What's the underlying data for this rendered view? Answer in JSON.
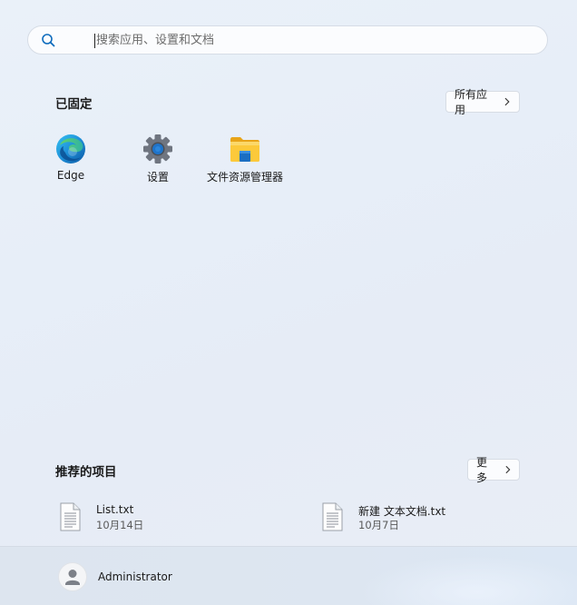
{
  "search": {
    "placeholder": "搜索应用、设置和文档"
  },
  "pinned": {
    "title": "已固定",
    "all_apps_label": "所有应用",
    "apps": [
      {
        "label": "Edge",
        "icon": "edge-icon"
      },
      {
        "label": "设置",
        "icon": "settings-gear-icon"
      },
      {
        "label": "文件资源管理器",
        "icon": "file-explorer-folder-icon"
      }
    ]
  },
  "recommended": {
    "title": "推荐的项目",
    "more_label": "更多",
    "items": [
      {
        "name": "List.txt",
        "date": "10月14日",
        "icon": "text-file-icon"
      },
      {
        "name": "新建 文本文档.txt",
        "date": "10月7日",
        "icon": "text-file-icon"
      }
    ]
  },
  "user": {
    "name": "Administrator",
    "icon": "user-avatar-icon"
  },
  "colors": {
    "accent": "#0f6cbd",
    "background": "#e8eff8"
  }
}
